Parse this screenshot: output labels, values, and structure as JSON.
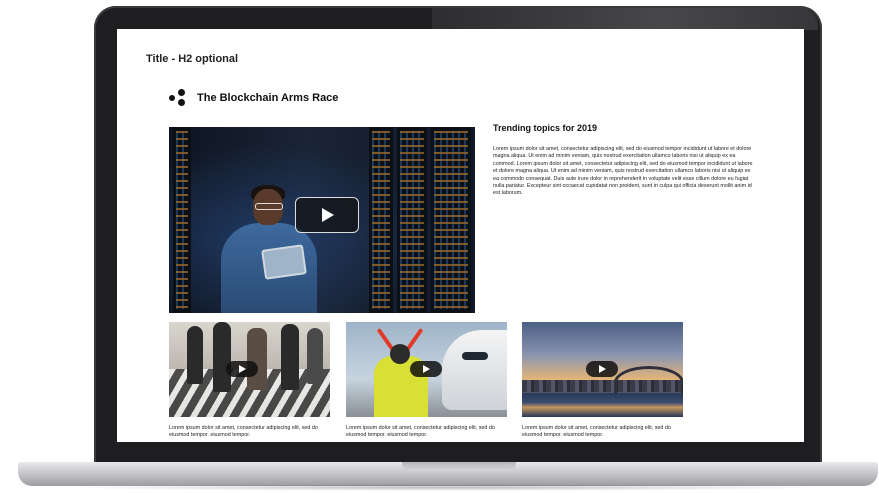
{
  "page": {
    "title": "Title - H2 optional"
  },
  "brand": {
    "name": "The Blockchain Arms Race",
    "logo_icon": "three-dots-logo"
  },
  "hero_video": {
    "play_icon": "play-icon"
  },
  "trending": {
    "title": "Trending topics for 2019",
    "body": "Lorem ipsum dolor sit amet, consectetur adipiscing elit, sed do eiusmod tempor incididunt ut labore et dolore magna aliqua. Ut enim ad minim veniam, quis nostrud exercitation ullamco laboris nisi ut aliquip ex ea commod. Lorem ipsum dolor sit amet, consectetur adipiscing elit, sed do eiusmod tempor incididunt ut labore et dolore magna aliqua. Ut enim ad minim veniam, quis nostrud exercitation ullamco laboris nisi ut aliquip ex ea commodo consequat. Duis aute irure dolor in reprehenderit in voluptate velit esse cillum dolore eu fugiat nulla pariatur. Excepteur sint occaecat cupidatat non proident, sunt in culpa qui officia deserunt mollit anim id est laborum."
  },
  "videos": [
    {
      "caption": "Lorem ipsum dolor sit amet, consectetur adipiscing elit, sed do eiusmod tempor. eiusmod tempor."
    },
    {
      "caption": "Lorem ipsum dolor sit amet, consectetur adipiscing elit, sed do eiusmod tempor. eiusmod tempor."
    },
    {
      "caption": "Lorem ipsum dolor sit amet, consectetur adipiscing elit, sed do eiusmod tempor.  eiusmod tempor."
    }
  ],
  "colors": {
    "laptop_frame": "#1e1e20",
    "laptop_base": "#c8c8cc",
    "screen_bg": "#ffffff",
    "text": "#222222"
  }
}
